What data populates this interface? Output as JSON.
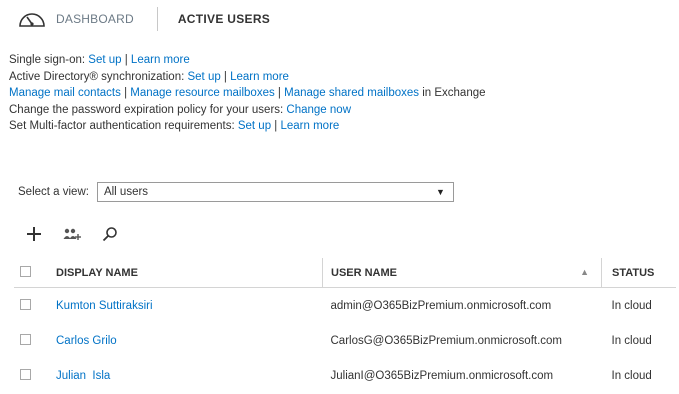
{
  "header": {
    "dashboard_label": "DASHBOARD",
    "active_label": "ACTIVE USERS"
  },
  "info": {
    "sso": {
      "text": "Single sign-on: ",
      "link1": "Set up",
      "sep": " | ",
      "link2": "Learn more"
    },
    "ad": {
      "text": "Active Directory® synchronization: ",
      "link1": "Set up",
      "sep": " |  ",
      "link2": "Learn more"
    },
    "mail": {
      "link1": "Manage mail contacts",
      "sep1": " | ",
      "link2": "Manage resource mailboxes",
      "sep2": " | ",
      "link3": "Manage shared mailboxes",
      "suffix": " in Exchange"
    },
    "password": {
      "text": "Change the password expiration policy for your users: ",
      "link1": "Change now"
    },
    "mfa": {
      "text": "Set Multi-factor authentication requirements: ",
      "link1": "Set up",
      "sep": " | ",
      "link2": "Learn more"
    }
  },
  "view": {
    "label": "Select a view:",
    "selected": "All users"
  },
  "toolbar": {
    "icons": [
      "add-icon",
      "bulk-add-users-icon",
      "search-icon"
    ]
  },
  "table": {
    "columns": {
      "name": "DISPLAY NAME",
      "user": "USER NAME",
      "status": "STATUS"
    },
    "rows": [
      {
        "name": "Kumton Suttiraksiri",
        "user": "admin@O365BizPremium.onmicrosoft.com",
        "status": "In cloud"
      },
      {
        "name": "Carlos Grilo",
        "user": "CarlosG@O365BizPremium.onmicrosoft.com",
        "status": "In cloud"
      },
      {
        "name": "Julian  Isla",
        "user": "JulianI@O365BizPremium.onmicrosoft.com",
        "status": "In cloud"
      }
    ]
  },
  "colors": {
    "link": "#0072c6",
    "text": "#333333",
    "nav_inactive": "#6c7a86"
  }
}
